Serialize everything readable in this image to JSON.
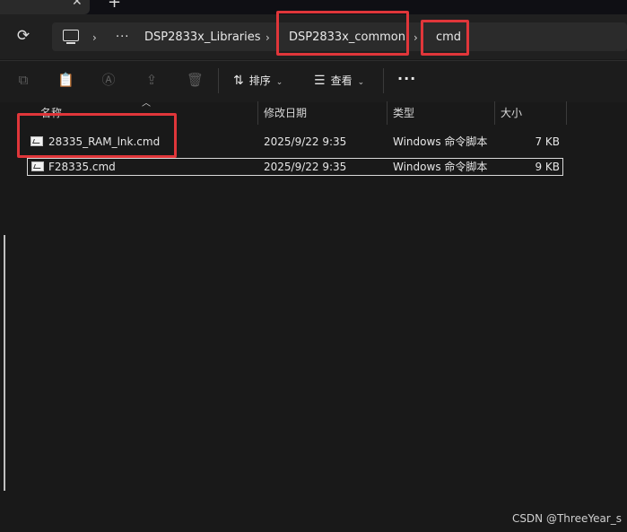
{
  "titlebar": {
    "close_glyph": "✕",
    "new_tab_glyph": "+"
  },
  "address_bar": {
    "overflow_glyph": "···",
    "crumbs": [
      "DSP2833x_Libraries",
      "DSP2833x_common",
      "cmd"
    ],
    "separator": "›"
  },
  "toolbar": {
    "sort_label": "排序",
    "view_label": "查看",
    "more_glyph": "···"
  },
  "columns": {
    "name": "名称",
    "modified": "修改日期",
    "type": "类型",
    "size": "大小"
  },
  "files": [
    {
      "name": "28335_RAM_lnk.cmd",
      "modified": "2025/9/22 9:35",
      "type": "Windows 命令脚本",
      "size": "7 KB"
    },
    {
      "name": "F28335.cmd",
      "modified": "2025/9/22 9:35",
      "type": "Windows 命令脚本",
      "size": "9 KB"
    }
  ],
  "watermark": "CSDN @ThreeYear_s",
  "colors": {
    "highlight": "#e0363a",
    "background": "#191919"
  }
}
